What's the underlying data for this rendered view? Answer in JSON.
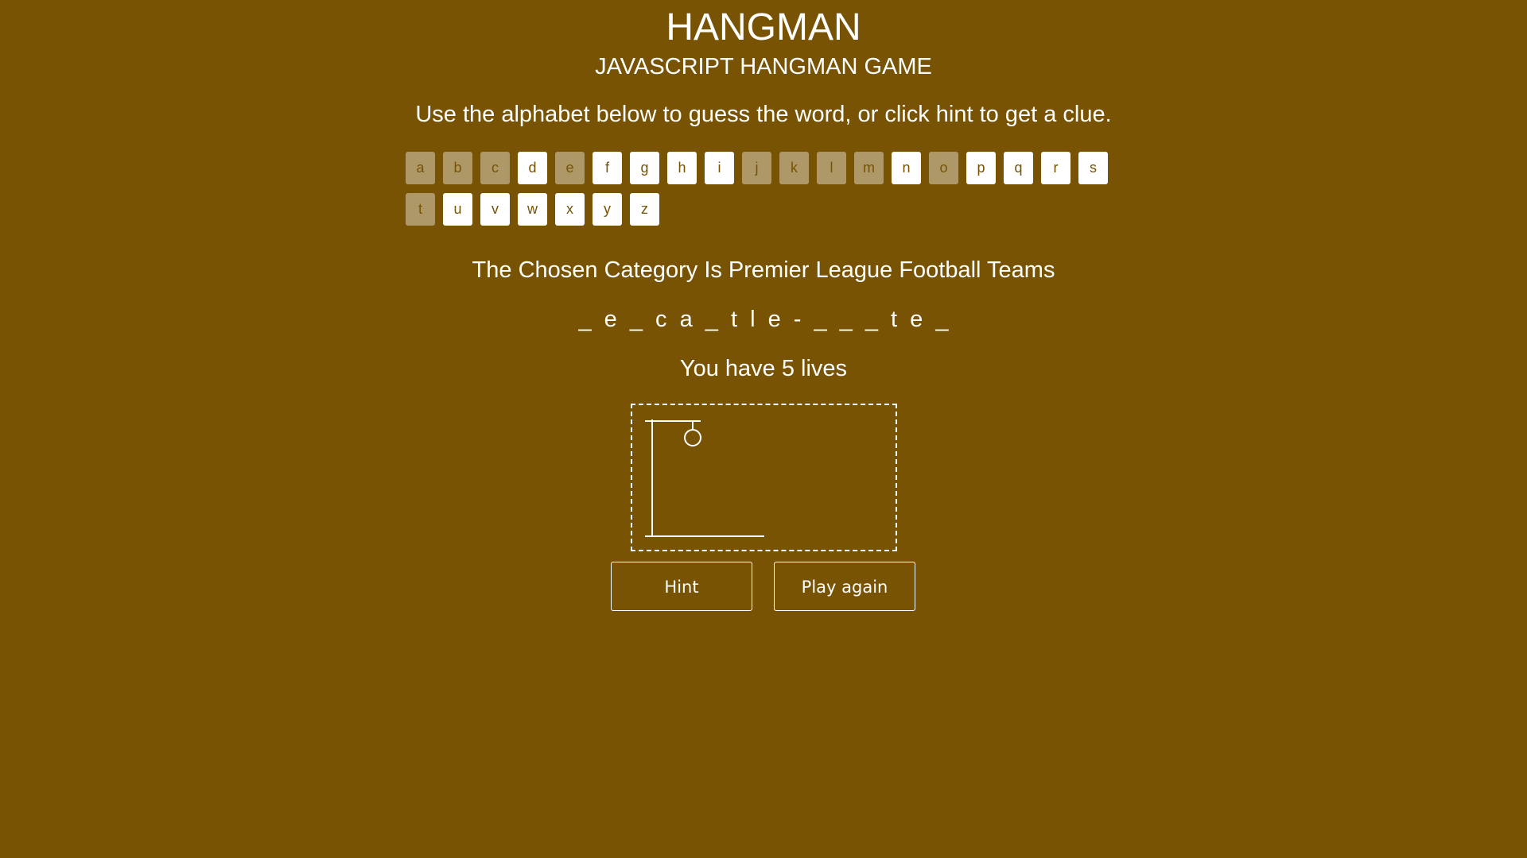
{
  "header": {
    "title": "HANGMAN",
    "subtitle": "JAVASCRIPT HANGMAN GAME",
    "instructions": "Use the alphabet below to guess the word, or click hint to get a clue."
  },
  "alphabet": [
    {
      "letter": "a",
      "used": true
    },
    {
      "letter": "b",
      "used": true
    },
    {
      "letter": "c",
      "used": true
    },
    {
      "letter": "d",
      "used": false
    },
    {
      "letter": "e",
      "used": true
    },
    {
      "letter": "f",
      "used": false
    },
    {
      "letter": "g",
      "used": false
    },
    {
      "letter": "h",
      "used": false
    },
    {
      "letter": "i",
      "used": false
    },
    {
      "letter": "j",
      "used": true
    },
    {
      "letter": "k",
      "used": true
    },
    {
      "letter": "l",
      "used": true
    },
    {
      "letter": "m",
      "used": true
    },
    {
      "letter": "n",
      "used": false
    },
    {
      "letter": "o",
      "used": true
    },
    {
      "letter": "p",
      "used": false
    },
    {
      "letter": "q",
      "used": false
    },
    {
      "letter": "r",
      "used": false
    },
    {
      "letter": "s",
      "used": false
    },
    {
      "letter": "t",
      "used": true
    },
    {
      "letter": "u",
      "used": false
    },
    {
      "letter": "v",
      "used": false
    },
    {
      "letter": "w",
      "used": false
    },
    {
      "letter": "x",
      "used": false
    },
    {
      "letter": "y",
      "used": false
    },
    {
      "letter": "z",
      "used": false
    }
  ],
  "game": {
    "category": "The Chosen Category Is Premier League Football Teams",
    "word_display": "_ e _ c a _ t l e - _ _ _ t e _",
    "lives_text": "You have 5 lives"
  },
  "buttons": {
    "hint": "Hint",
    "play_again": "Play again"
  },
  "colors": {
    "background": "#785303",
    "foreground": "#ffffff"
  }
}
